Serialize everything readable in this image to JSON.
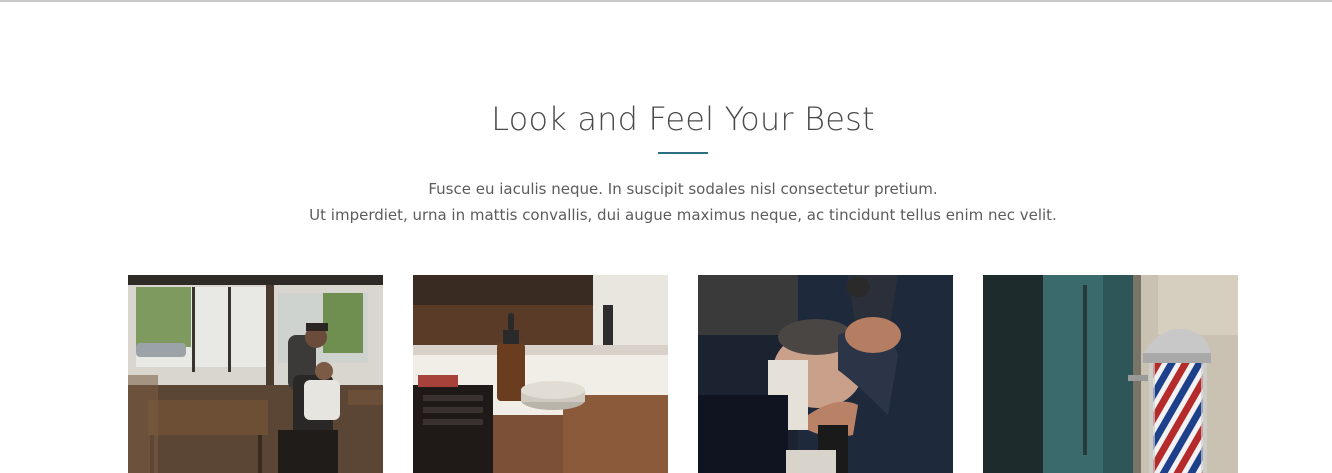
{
  "section": {
    "title": "Look and Feel Your Best",
    "accent_color": "#2b6f83",
    "description_lines": [
      "Fusce eu iaculis neque. In suscipit sodales nisl consectetur pretium.",
      "Ut imperdiet, urna in mattis convallis, dui augue maximus neque, ac tincidunt tellus enim nec velit."
    ]
  },
  "gallery": [
    {
      "image": "barbershop-interior-photo"
    },
    {
      "image": "beard-oil-and-grooming-products-photo"
    },
    {
      "image": "straight-razor-shave-photo"
    },
    {
      "image": "barber-pole-photo"
    }
  ]
}
